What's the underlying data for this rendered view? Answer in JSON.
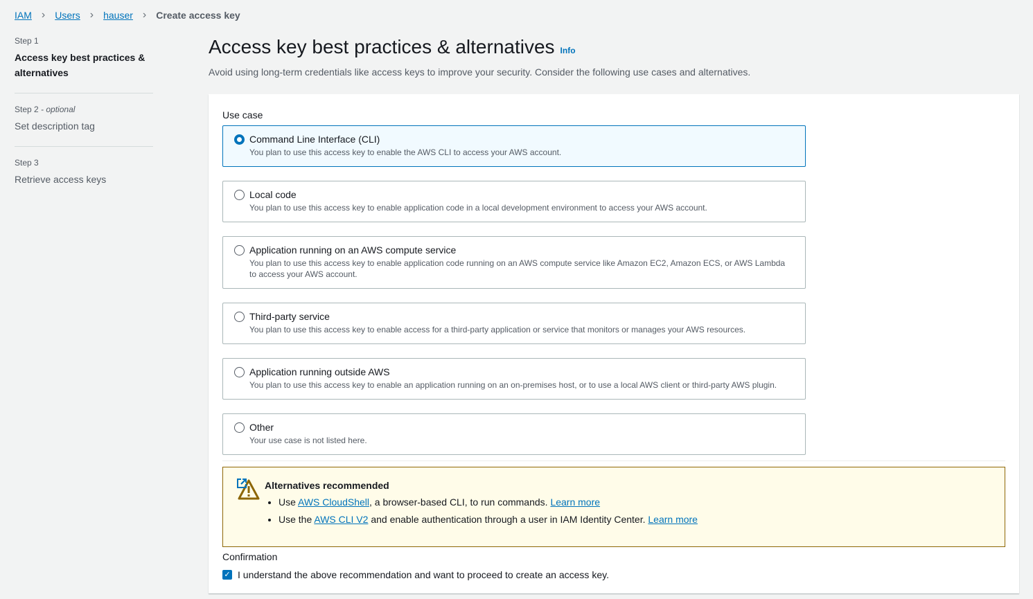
{
  "breadcrumb": {
    "items": [
      "IAM",
      "Users",
      "hauser"
    ],
    "current": "Create access key"
  },
  "steps": [
    {
      "num": "Step 1",
      "title": "Access key best practices & alternatives"
    },
    {
      "num": "Step 2",
      "optional": "- optional",
      "title": "Set description tag"
    },
    {
      "num": "Step 3",
      "title": "Retrieve access keys"
    }
  ],
  "page": {
    "title": "Access key best practices & alternatives",
    "info": "Info",
    "description": "Avoid using long-term credentials like access keys to improve your security. Consider the following use cases and alternatives."
  },
  "use_case": {
    "label": "Use case",
    "options": [
      {
        "title": "Command Line Interface (CLI)",
        "desc": "You plan to use this access key to enable the AWS CLI to access your AWS account.",
        "selected": true
      },
      {
        "title": "Local code",
        "desc": "You plan to use this access key to enable application code in a local development environment to access your AWS account."
      },
      {
        "title": "Application running on an AWS compute service",
        "desc": "You plan to use this access key to enable application code running on an AWS compute service like Amazon EC2, Amazon ECS, or AWS Lambda to access your AWS account."
      },
      {
        "title": "Third-party service",
        "desc": "You plan to use this access key to enable access for a third-party application or service that monitors or manages your AWS resources."
      },
      {
        "title": "Application running outside AWS",
        "desc": "You plan to use this access key to enable an application running on an on-premises host, or to use a local AWS client or third-party AWS plugin."
      },
      {
        "title": "Other",
        "desc": "Your use case is not listed here."
      }
    ]
  },
  "alert": {
    "title": "Alternatives recommended",
    "items": [
      {
        "pre": "Use ",
        "link": "AWS CloudShell",
        "post": ", a browser-based CLI, to run commands. ",
        "learn": "Learn more"
      },
      {
        "pre": "Use the ",
        "link": "AWS CLI V2",
        "post": " and enable authentication through a user in IAM Identity Center. ",
        "learn": "Learn more"
      }
    ]
  },
  "confirmation": {
    "label": "Confirmation",
    "checkbox": "I understand the above recommendation and want to proceed to create an access key.",
    "checked": true
  }
}
